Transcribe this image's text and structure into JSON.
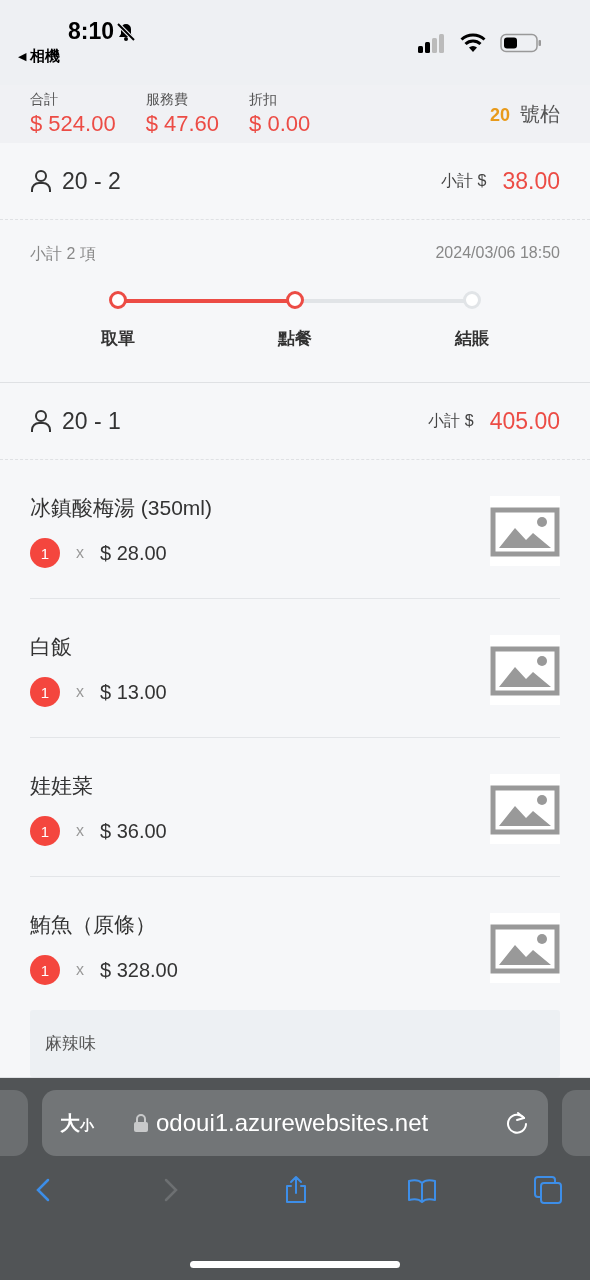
{
  "status_bar": {
    "time": "8:10",
    "back_arrow": "◀",
    "back_label": "相機",
    "silent": true
  },
  "summary": {
    "totals": [
      {
        "label": "合計",
        "amount": "$ 524.00"
      },
      {
        "label": "服務費",
        "amount": "$ 47.60"
      },
      {
        "label": "折扣",
        "amount": "$ 0.00"
      }
    ],
    "table_number": "20",
    "table_suffix": "號枱"
  },
  "groups": [
    {
      "guest": "20 - 2",
      "subtotal_label": "小計 $",
      "subtotal": "38.00",
      "item_count": "小計 2 項",
      "time": "2024/03/06 18:50",
      "steps": [
        {
          "label": "取單",
          "reached": true
        },
        {
          "label": "點餐",
          "reached": true
        },
        {
          "label": "結賬",
          "reached": false
        }
      ]
    },
    {
      "guest": "20 - 1",
      "subtotal_label": "小計 $",
      "subtotal": "405.00",
      "items": [
        {
          "name": "冰鎮酸梅湯 (350ml)",
          "quantity": "1",
          "times": "x",
          "price": "$ 28.00"
        },
        {
          "name": "白飯",
          "quantity": "1",
          "times": "x",
          "price": "$ 13.00"
        },
        {
          "name": "娃娃菜",
          "quantity": "1",
          "times": "x",
          "price": "$ 36.00"
        },
        {
          "name": "鮪魚（原條）",
          "quantity": "1",
          "times": "x",
          "price": "$ 328.00",
          "note": "麻辣味"
        }
      ]
    }
  ],
  "browser": {
    "text_size_large": "大",
    "text_size_small": "小",
    "url": "odoui1.azurewebsites.net",
    "toolbar": [
      {
        "kind": "back",
        "disabled": false
      },
      {
        "kind": "forward",
        "disabled": true
      },
      {
        "kind": "share",
        "disabled": false
      },
      {
        "kind": "bookmarks",
        "disabled": false
      },
      {
        "kind": "tabs",
        "disabled": false
      }
    ]
  }
}
